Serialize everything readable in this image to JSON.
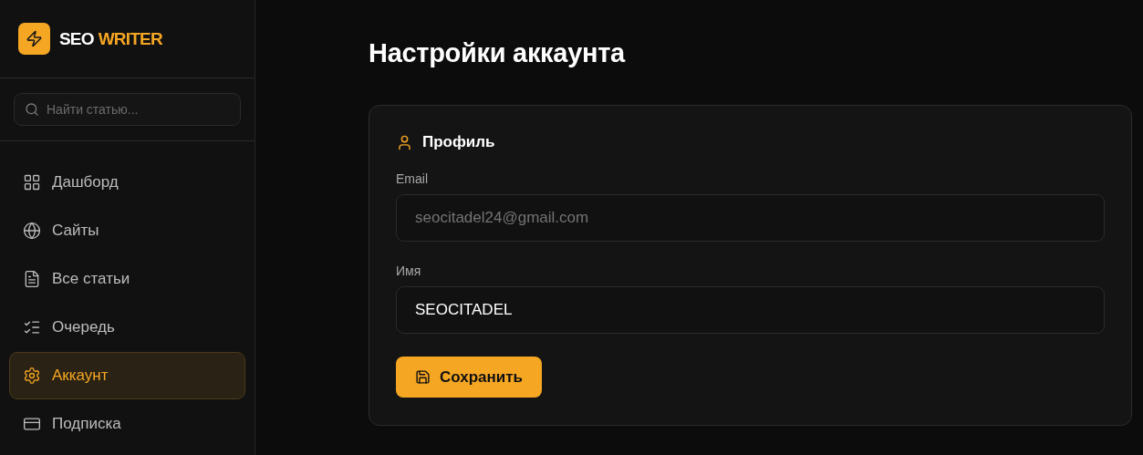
{
  "logo": {
    "part_1": "SEO",
    "part_2": "WRITER"
  },
  "search": {
    "placeholder": "Найти статью..."
  },
  "nav": [
    {
      "kind": "dashboard",
      "label": "Дашборд",
      "selected": false
    },
    {
      "kind": "sites",
      "label": "Сайты",
      "selected": false
    },
    {
      "kind": "articles",
      "label": "Все статьи",
      "selected": false
    },
    {
      "kind": "queue",
      "label": "Очередь",
      "selected": false
    },
    {
      "kind": "account",
      "label": "Аккаунт",
      "selected": true
    },
    {
      "kind": "subscription",
      "label": "Подписка",
      "selected": false
    }
  ],
  "page_title": "Настройки аккаунта",
  "profile": {
    "title": "Профиль",
    "fields": [
      {
        "label": "Email",
        "value": "seocitadel24@gmail.com",
        "disabled": true
      },
      {
        "label": "Имя",
        "value": "SEOCITADEL",
        "disabled": false
      }
    ],
    "save_button": "Сохранить"
  }
}
